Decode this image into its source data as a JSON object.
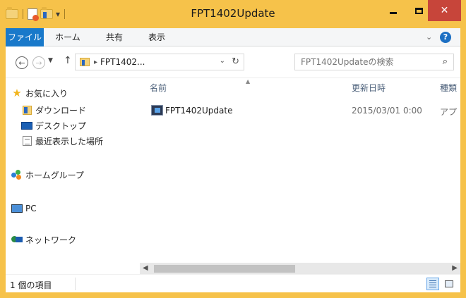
{
  "window": {
    "title": "FPT1402Update",
    "colors": {
      "frame": "#f6c24a",
      "close": "#c7453a",
      "file_tab": "#1979ca"
    }
  },
  "ribbon": {
    "tabs": [
      {
        "label": "ファイル",
        "active": true
      },
      {
        "label": "ホーム"
      },
      {
        "label": "共有"
      },
      {
        "label": "表示"
      }
    ],
    "expand_icon": "chevron-down-icon",
    "help_glyph": "?"
  },
  "address": {
    "path": "FPT1402...",
    "search_placeholder": "FPT1402Updateの検索"
  },
  "nav_pane": {
    "favorites": "お気に入り",
    "downloads": "ダウンロード",
    "desktop": "デスクトップ",
    "recent": "最近表示した場所",
    "homegroup": "ホームグループ",
    "pc": "PC",
    "network": "ネットワーク"
  },
  "columns": {
    "name": "名前",
    "date": "更新日時",
    "type": "種類"
  },
  "files": [
    {
      "name": "FPT1402Update",
      "date": "2015/03/01 0:00",
      "type": "アプ"
    }
  ],
  "status": {
    "item_count": "1 個の項目"
  }
}
